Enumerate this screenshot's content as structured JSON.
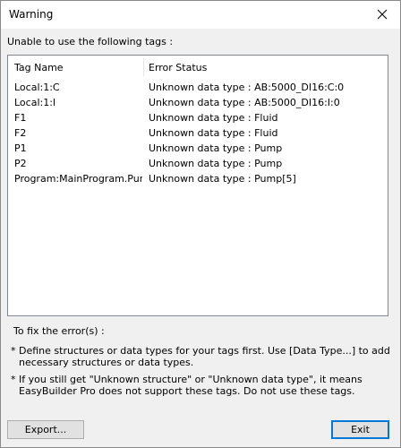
{
  "window": {
    "title": "Warning",
    "close_icon": "close-icon"
  },
  "intro_text": "Unable to use the following tags :",
  "tag_list": {
    "columns": [
      "Tag Name",
      "Error Status"
    ],
    "rows": [
      {
        "tag": "Local:1:C",
        "status": "Unknown data type : AB:5000_DI16:C:0"
      },
      {
        "tag": "Local:1:I",
        "status": "Unknown data type : AB:5000_DI16:I:0"
      },
      {
        "tag": "F1",
        "status": "Unknown data type : Fluid"
      },
      {
        "tag": "F2",
        "status": "Unknown data type : Fluid"
      },
      {
        "tag": "P1",
        "status": "Unknown data type : Pump"
      },
      {
        "tag": "P2",
        "status": "Unknown data type : Pump"
      },
      {
        "tag": "Program:MainProgram.Pum...",
        "status": "Unknown data type : Pump[5]"
      }
    ]
  },
  "fix": {
    "title": "To fix the error(s) :",
    "notes": [
      {
        "bullet": "*",
        "text": "Define structures or data types for your tags first. Use [Data Type...] to add necessary structures or data types."
      },
      {
        "bullet": "*",
        "text": "If you still get \"Unknown structure\" or \"Unknown data type\", it means EasyBuilder Pro does not support these tags. Do not use these tags."
      }
    ]
  },
  "buttons": {
    "export_label": "Export...",
    "exit_label": "Exit"
  },
  "colors": {
    "dialog_bg": "#f0f0f0",
    "titlebar_bg": "#ffffff",
    "default_button_border": "#0078d7"
  }
}
